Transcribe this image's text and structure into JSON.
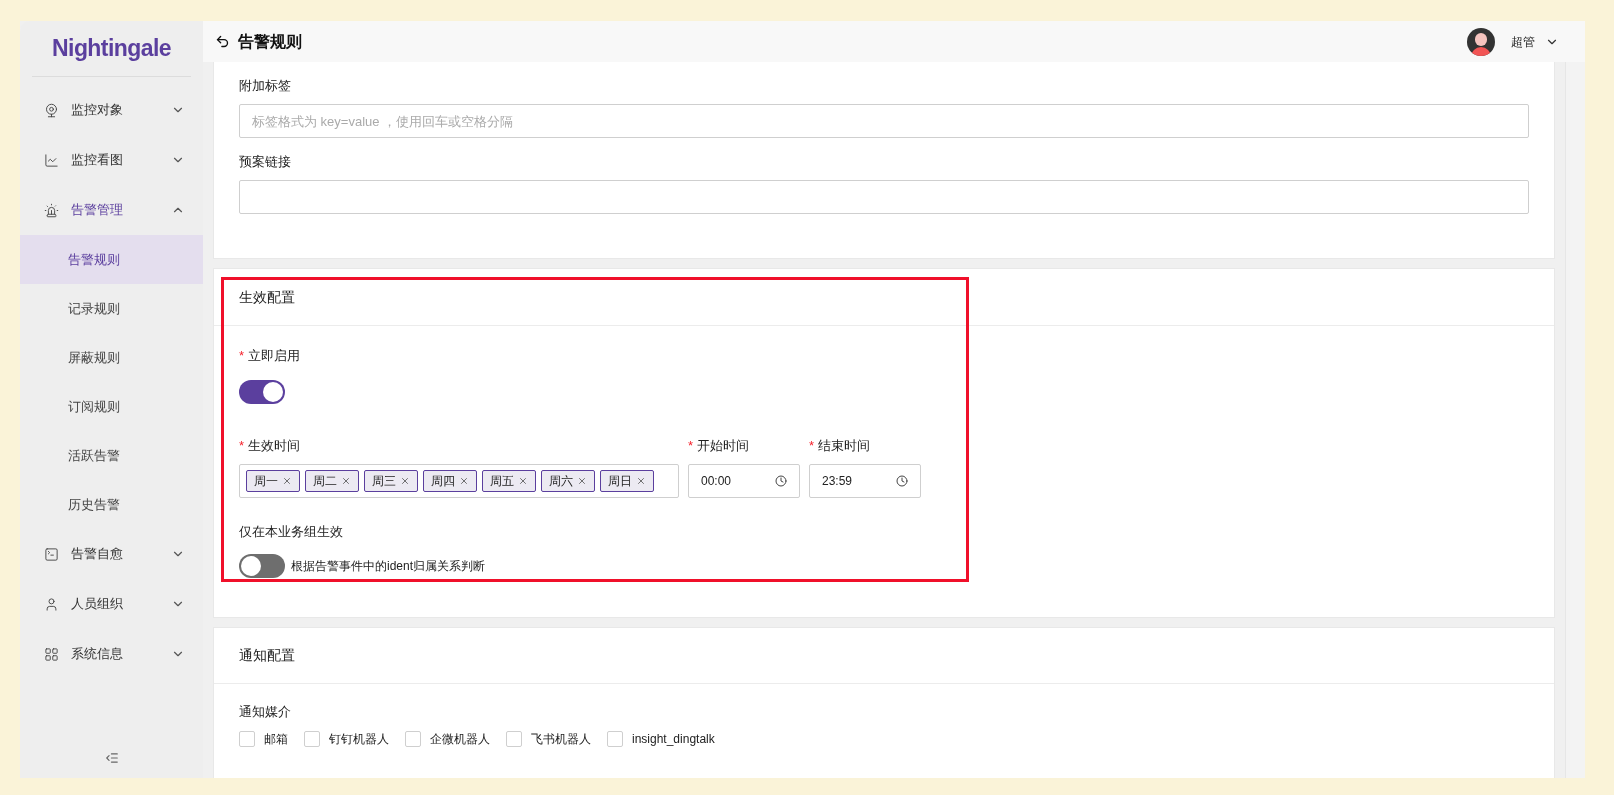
{
  "sidebar": {
    "logo": "Nightingale",
    "items": [
      {
        "label": "监控对象",
        "expanded": false
      },
      {
        "label": "监控看图",
        "expanded": false
      },
      {
        "label": "告警管理",
        "expanded": true,
        "children": [
          {
            "label": "告警规则",
            "selected": true
          },
          {
            "label": "记录规则",
            "selected": false
          },
          {
            "label": "屏蔽规则",
            "selected": false
          },
          {
            "label": "订阅规则",
            "selected": false
          },
          {
            "label": "活跃告警",
            "selected": false
          },
          {
            "label": "历史告警",
            "selected": false
          }
        ]
      },
      {
        "label": "告警自愈",
        "expanded": false
      },
      {
        "label": "人员组织",
        "expanded": false
      },
      {
        "label": "系统信息",
        "expanded": false
      }
    ]
  },
  "header": {
    "title": "告警规则",
    "user": "超管"
  },
  "extra_card": {
    "fields": [
      {
        "label": "附加标签",
        "placeholder": "标签格式为 key=value ，使用回车或空格分隔"
      },
      {
        "label": "预案链接"
      }
    ]
  },
  "effective_card": {
    "title": "生效配置",
    "enable_now": {
      "label": "立即启用",
      "required": "*",
      "on": true
    },
    "days": {
      "label": "生效时间",
      "required": "*",
      "tags": [
        "周一",
        "周二",
        "周三",
        "周四",
        "周五",
        "周六",
        "周日"
      ]
    },
    "start_time": {
      "label": "开始时间",
      "required": "*",
      "value": "00:00"
    },
    "end_time": {
      "label": "结束时间",
      "required": "*",
      "value": "23:59"
    },
    "group_only": {
      "label": "仅在本业务组生效",
      "on": false,
      "hint": "根据告警事件中的ident归属关系判断"
    }
  },
  "notify_card": {
    "title": "通知配置",
    "media_label": "通知媒介",
    "media": [
      {
        "label": "邮箱",
        "checked": false
      },
      {
        "label": "钉钉机器人",
        "checked": false
      },
      {
        "label": "企微机器人",
        "checked": false
      },
      {
        "label": "飞书机器人",
        "checked": false
      },
      {
        "label": "insight_dingtalk",
        "checked": false
      }
    ]
  }
}
